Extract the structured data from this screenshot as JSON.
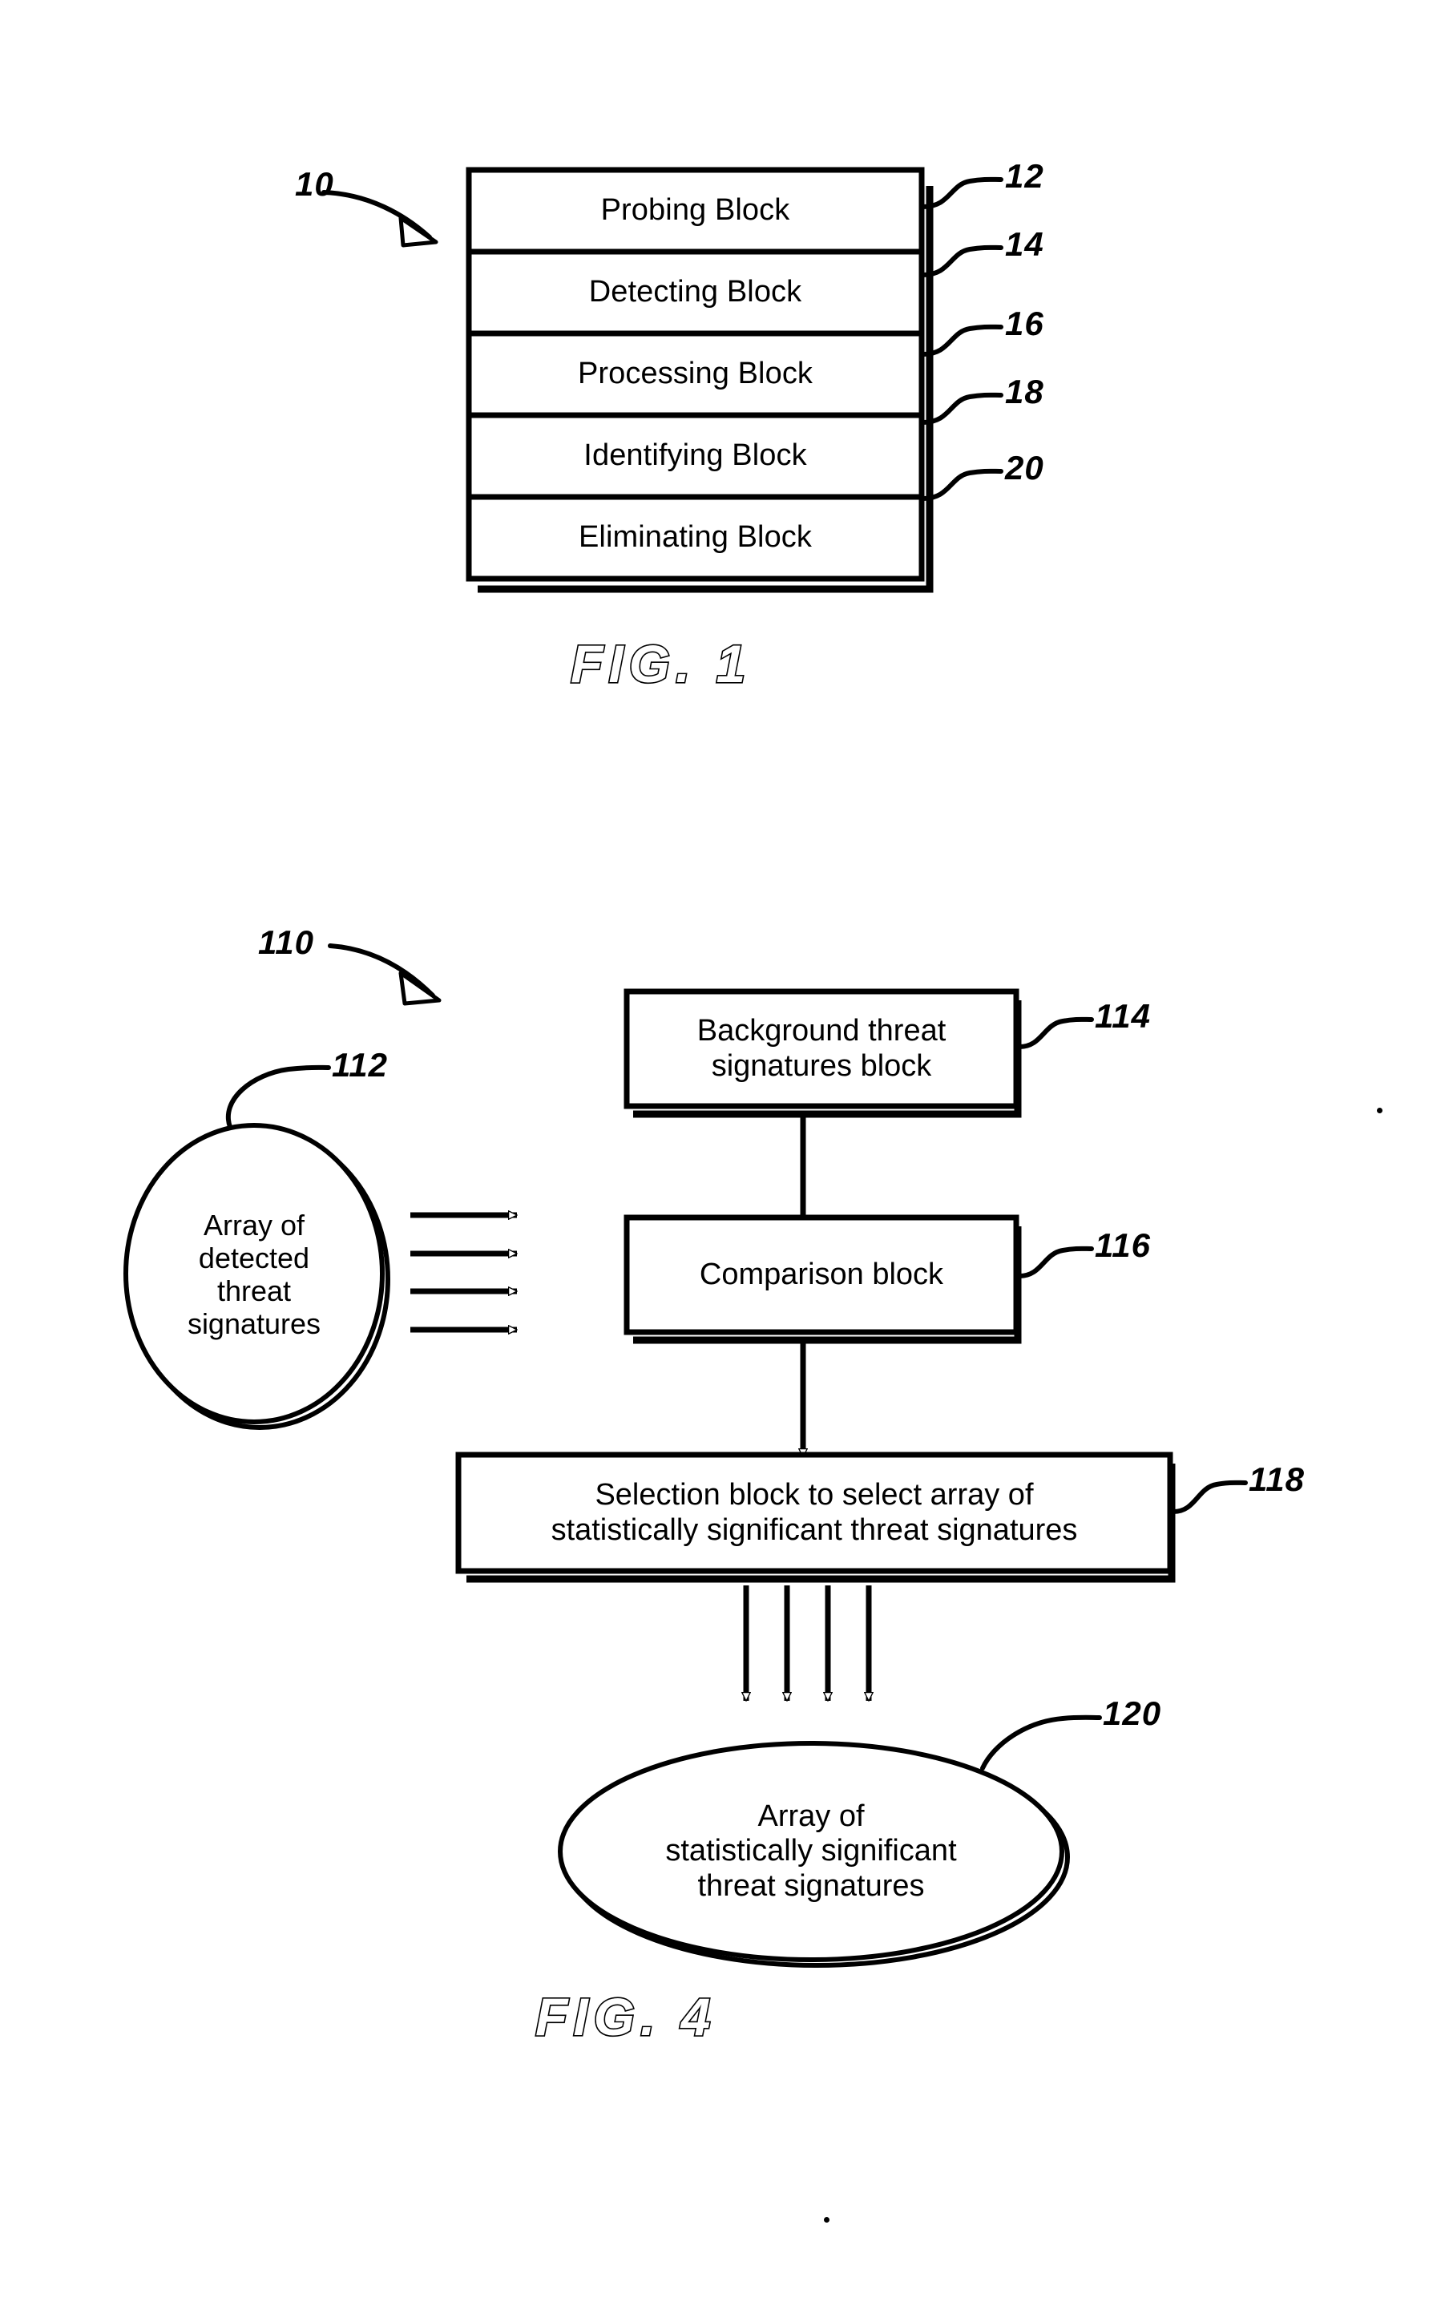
{
  "document": {
    "type": "patent-drawing-sheet",
    "background_color": "#ffffff",
    "ink_color": "#000000"
  },
  "figure1": {
    "caption": "FIG. 1",
    "assembly_ref": "10",
    "blocks": [
      {
        "label": "Probing Block",
        "ref": "12"
      },
      {
        "label": "Detecting Block",
        "ref": "14"
      },
      {
        "label": "Processing Block",
        "ref": "16"
      },
      {
        "label": "Identifying Block",
        "ref": "18"
      },
      {
        "label": "Eliminating Block",
        "ref": "20"
      }
    ]
  },
  "figure4": {
    "caption": "FIG. 4",
    "assembly_ref": "110",
    "nodes": {
      "detected_array": {
        "ref": "112",
        "shape": "ellipse",
        "label": "Array of\ndetected\nthreat\nsignatures"
      },
      "background_block": {
        "ref": "114",
        "shape": "rect",
        "label": "Background threat\nsignatures block"
      },
      "comparison_block": {
        "ref": "116",
        "shape": "rect",
        "label": "Comparison block"
      },
      "selection_block": {
        "ref": "118",
        "shape": "rect",
        "label": "Selection block to select array of\nstatistically significant threat signatures"
      },
      "significant_array": {
        "ref": "120",
        "shape": "ellipse",
        "label": "Array of\nstatistically significant\nthreat signatures"
      }
    },
    "flows": [
      {
        "from": "detected_array",
        "to": "comparison_block",
        "count": 4,
        "direction": "right"
      },
      {
        "from": "background_block",
        "to": "comparison_block",
        "count": 1,
        "direction": "down"
      },
      {
        "from": "comparison_block",
        "to": "selection_block",
        "count": 1,
        "direction": "down"
      },
      {
        "from": "selection_block",
        "to": "significant_array",
        "count": 4,
        "direction": "down"
      }
    ]
  }
}
